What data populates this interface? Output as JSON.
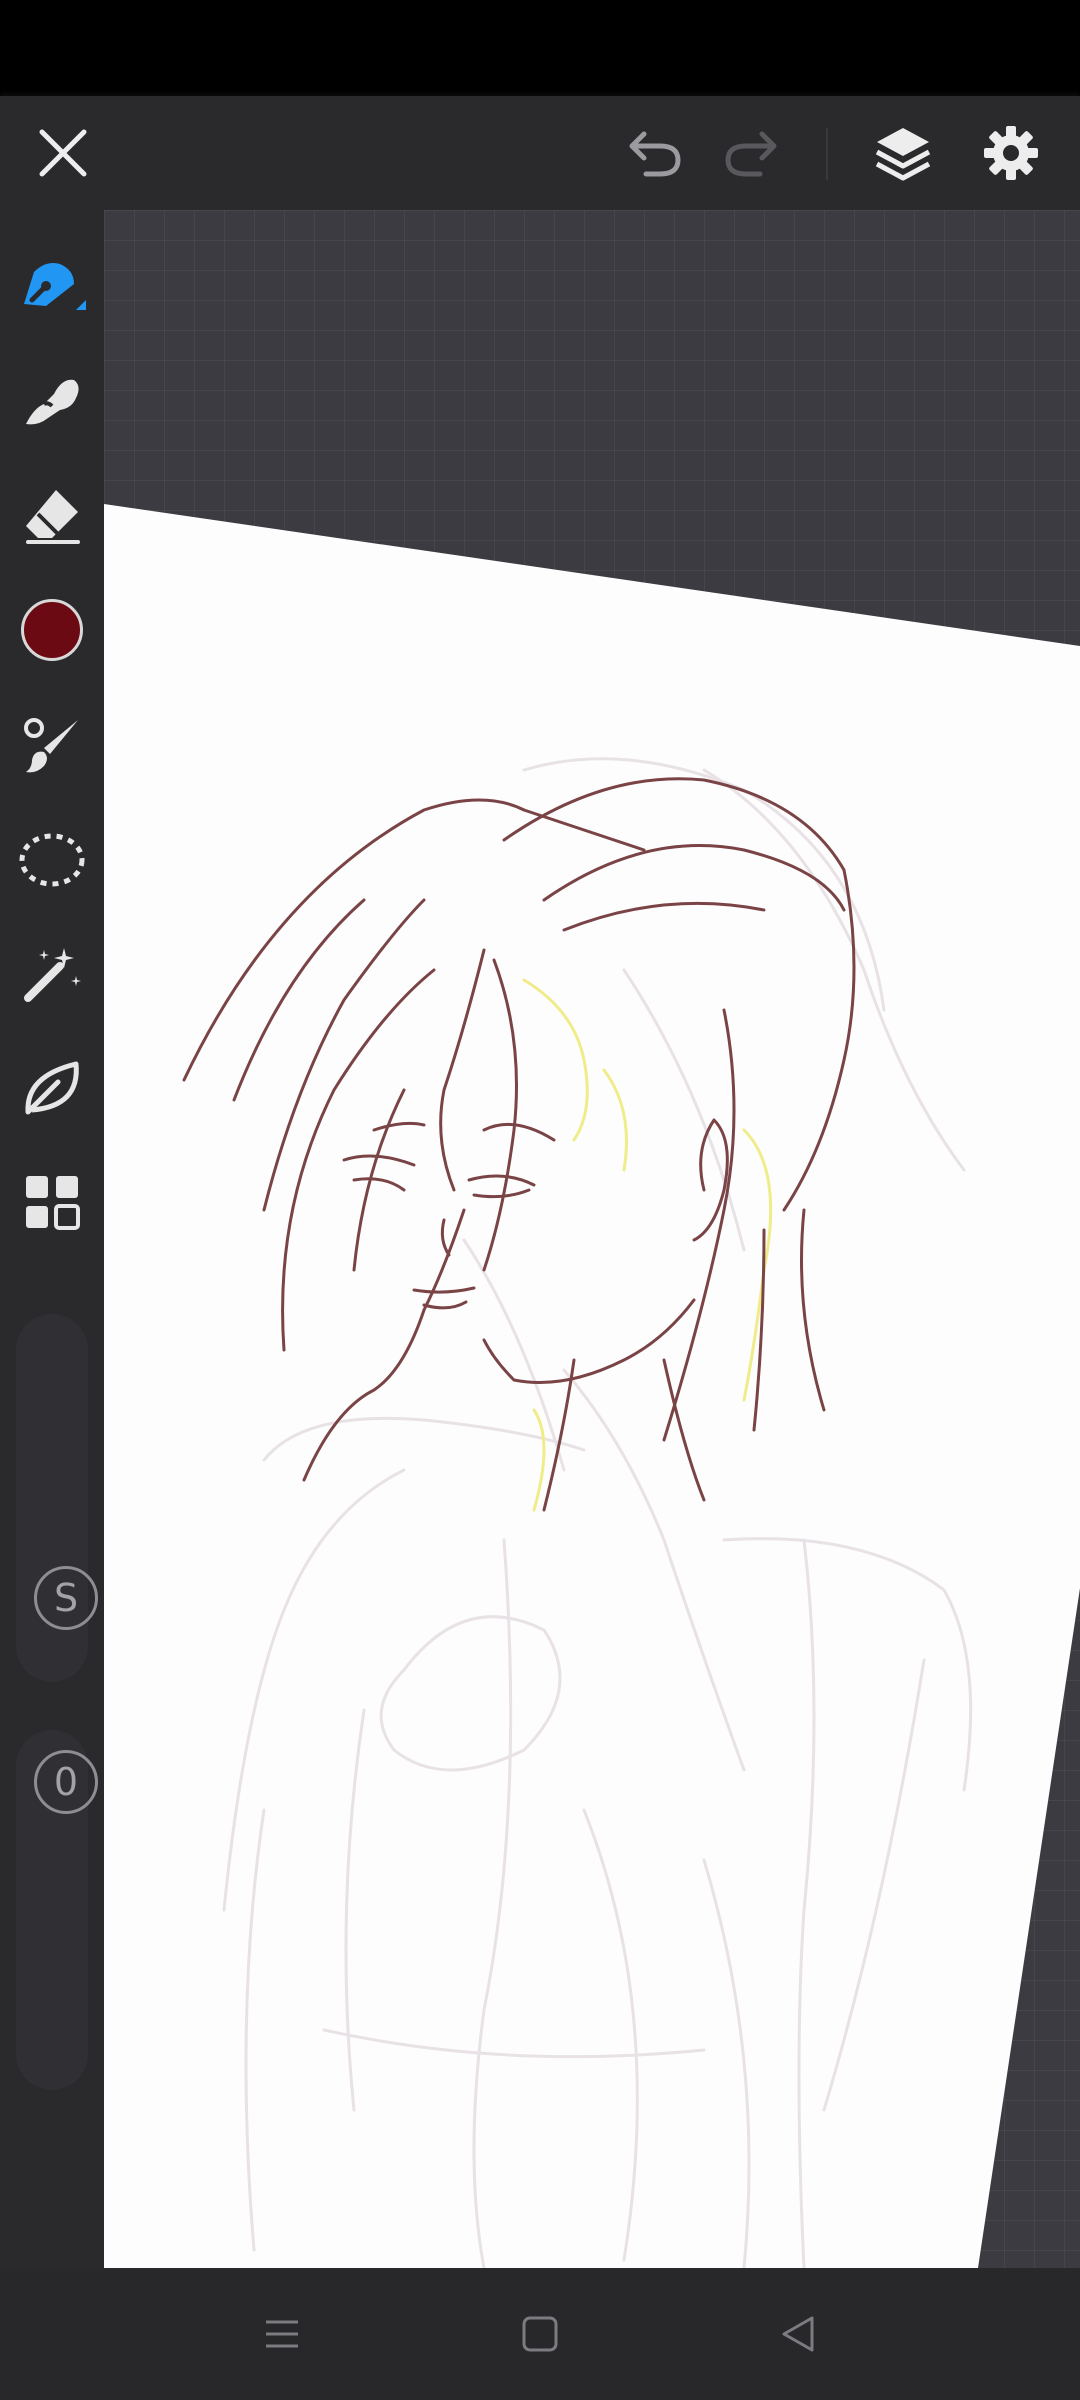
{
  "top_toolbar": {
    "buttons": [
      "close-icon",
      "undo-icon",
      "redo-icon",
      "layers-icon",
      "settings-gear-icon"
    ],
    "undo_enabled": true,
    "redo_enabled": false
  },
  "left_toolbar": {
    "tools": [
      "pencil-brush-icon",
      "smudge-icon",
      "eraser-icon",
      "color-swatch",
      "paint-brush-icon",
      "lasso-select-icon",
      "magic-wand-icon",
      "leaf-shape-icon",
      "grid-menu-icon"
    ],
    "active_tool": "pencil-brush-icon",
    "current_color": "#6b0a12",
    "accent_color": "#2196f3",
    "size_slider": {
      "label": "S"
    },
    "opacity_slider": {
      "label": "0"
    }
  },
  "nav_bar": {
    "buttons": [
      "menu-icon",
      "home-icon",
      "back-icon"
    ]
  }
}
